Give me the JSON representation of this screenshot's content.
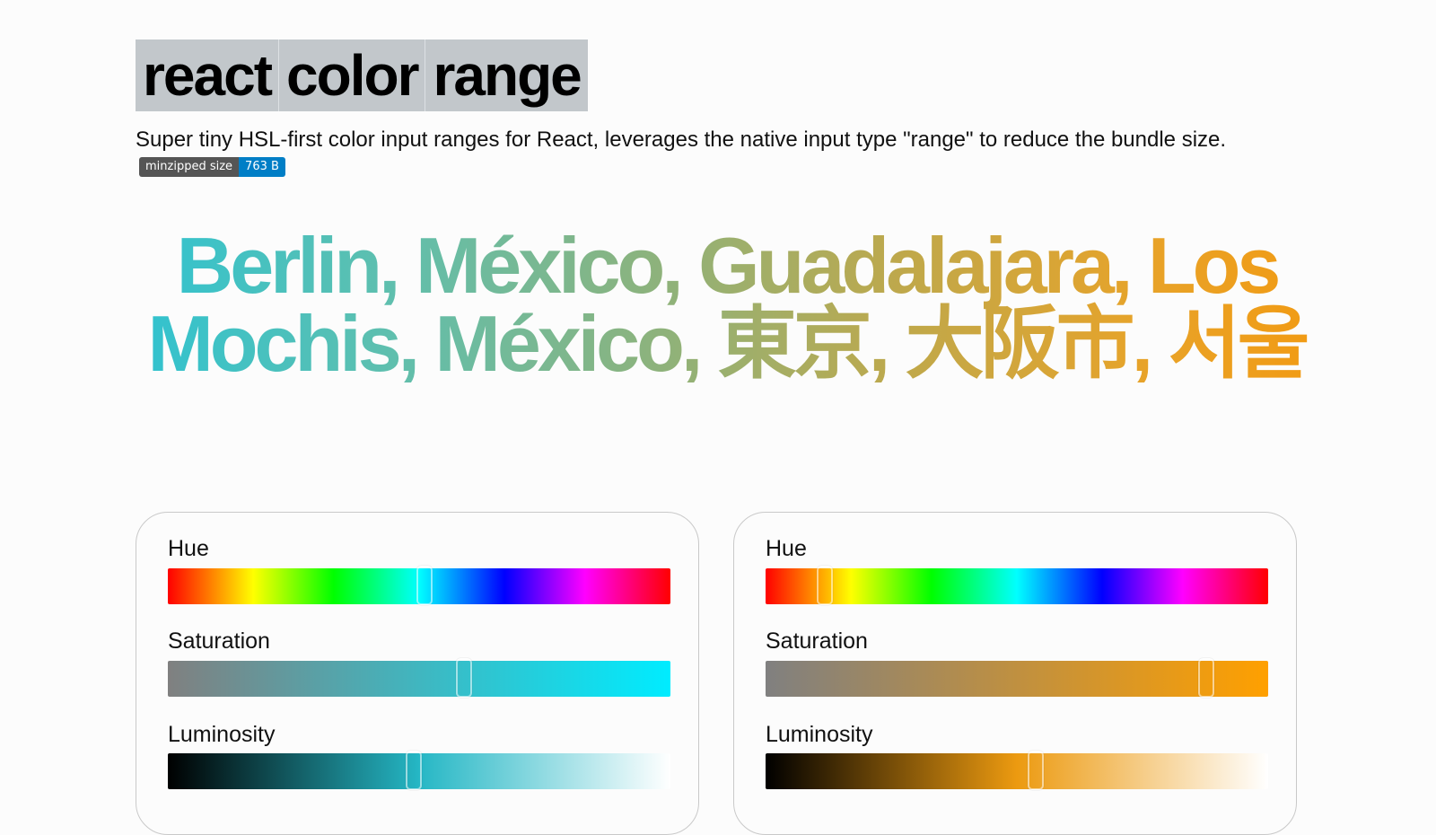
{
  "header": {
    "title_words": [
      "react",
      "color",
      "range"
    ],
    "description": "Super tiny HSL-first color input ranges for React, leverages the native input type \"range\" to reduce the bundle size.",
    "badge": {
      "label": "minzipped size",
      "value": "763 B"
    }
  },
  "showcase": {
    "text": "Berlin, México, Guadalajara, Los Mochis, México, 東京, 大阪市, 서울"
  },
  "pickers": [
    {
      "hue_label": "Hue",
      "hue": 0.511,
      "saturation_label": "Saturation",
      "saturation": 0.589,
      "luminosity_label": "Luminosity",
      "luminosity": 0.49,
      "colors": {
        "sat_start": "#808080",
        "sat_end": "#00ecff",
        "lum_mid": "#25b7c5"
      }
    },
    {
      "hue_label": "Hue",
      "hue": 0.118,
      "saturation_label": "Saturation",
      "saturation": 0.876,
      "luminosity_label": "Luminosity",
      "luminosity": 0.538,
      "colors": {
        "sat_start": "#808080",
        "sat_end": "#ffa000",
        "lum_mid": "#ec9a10"
      }
    }
  ]
}
